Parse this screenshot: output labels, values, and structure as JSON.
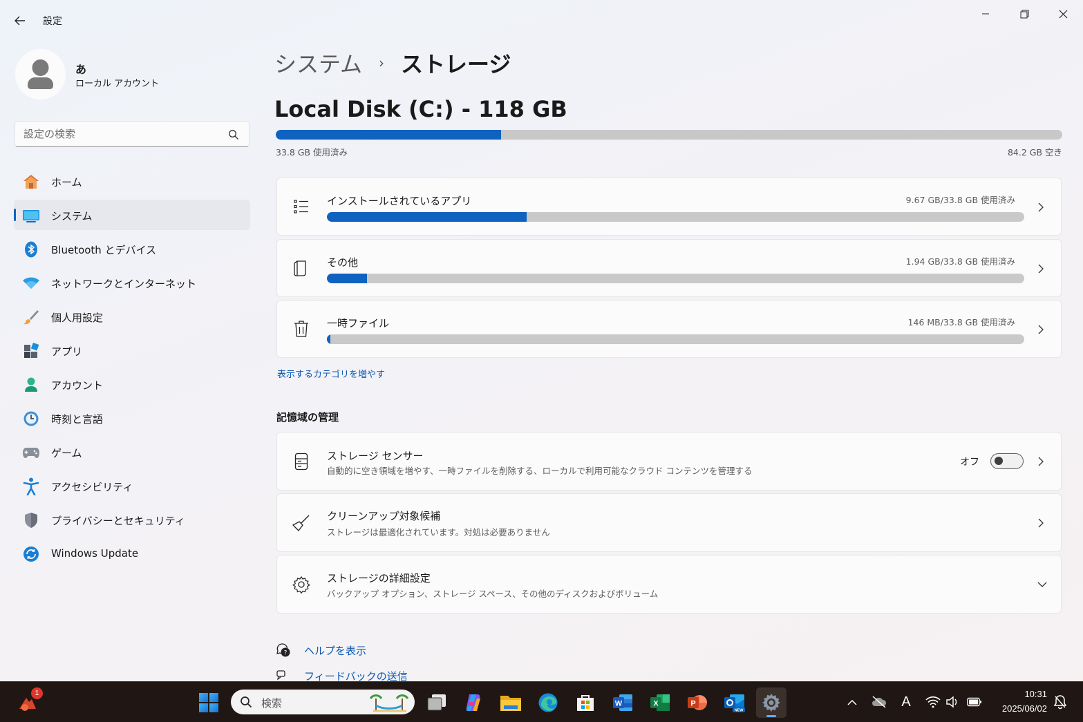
{
  "window": {
    "title": "設定"
  },
  "profile": {
    "name": "あ",
    "account_type": "ローカル アカウント"
  },
  "search": {
    "placeholder": "設定の検索"
  },
  "sidebar": {
    "items": [
      {
        "label": "ホーム",
        "icon": "home-icon"
      },
      {
        "label": "システム",
        "icon": "system-icon",
        "active": true
      },
      {
        "label": "Bluetooth とデバイス",
        "icon": "bluetooth-icon"
      },
      {
        "label": "ネットワークとインターネット",
        "icon": "wifi-icon"
      },
      {
        "label": "個人用設定",
        "icon": "brush-icon"
      },
      {
        "label": "アプリ",
        "icon": "apps-icon"
      },
      {
        "label": "アカウント",
        "icon": "account-icon"
      },
      {
        "label": "時刻と言語",
        "icon": "time-language-icon"
      },
      {
        "label": "ゲーム",
        "icon": "gamepad-icon"
      },
      {
        "label": "アクセシビリティ",
        "icon": "accessibility-icon"
      },
      {
        "label": "プライバシーとセキュリティ",
        "icon": "shield-icon"
      },
      {
        "label": "Windows Update",
        "icon": "update-icon"
      }
    ]
  },
  "breadcrumb": {
    "parent": "システム",
    "separator": "›",
    "current": "ストレージ"
  },
  "disk": {
    "title": "Local Disk (C:) - 118 GB",
    "used_label": "33.8 GB 使用済み",
    "free_label": "84.2 GB 空き",
    "used_fraction": 0.2864
  },
  "categories": [
    {
      "label": "インストールされているアプリ",
      "usage": "9.67 GB/33.8 GB 使用済み",
      "fraction": 0.286,
      "icon": "list-icon"
    },
    {
      "label": "その他",
      "usage": "1.94 GB/33.8 GB 使用済み",
      "fraction": 0.057,
      "icon": "other-files-icon"
    },
    {
      "label": "一時ファイル",
      "usage": "146 MB/33.8 GB 使用済み",
      "fraction": 0.004,
      "icon": "trash-icon"
    }
  ],
  "more_categories_link": "表示するカテゴリを増やす",
  "management": {
    "title": "記憶域の管理",
    "items": [
      {
        "label": "ストレージ センサー",
        "sub": "自動的に空き領域を増やす、一時ファイルを削除する、ローカルで利用可能なクラウド コンテンツを管理する",
        "toggle_label": "オフ",
        "toggle_on": false,
        "icon": "storage-sense-icon"
      },
      {
        "label": "クリーンアップ対象候補",
        "sub": "ストレージは最適化されています。対処は必要ありません",
        "icon": "broom-icon"
      },
      {
        "label": "ストレージの詳細設定",
        "sub": "バックアップ オプション、ストレージ スペース、その他のディスクおよびボリューム",
        "icon": "gear-icon"
      }
    ]
  },
  "help": {
    "show_help": "ヘルプを表示",
    "feedback": "フィードバックの送信"
  },
  "taskbar": {
    "search_placeholder": "検索",
    "notification_count": "1",
    "time": "10:31",
    "date": "2025/06/02",
    "ime_label": "A",
    "apps": [
      "start-icon",
      "task-view-icon",
      "copilot-icon",
      "file-explorer-icon",
      "edge-icon",
      "store-icon",
      "word-icon",
      "excel-icon",
      "powerpoint-icon",
      "outlook-icon",
      "settings-icon"
    ]
  },
  "colors": {
    "accent": "#0f62c0",
    "bar_track": "#c9c9c9",
    "link": "#0a58b0",
    "taskbar": "#201714"
  }
}
